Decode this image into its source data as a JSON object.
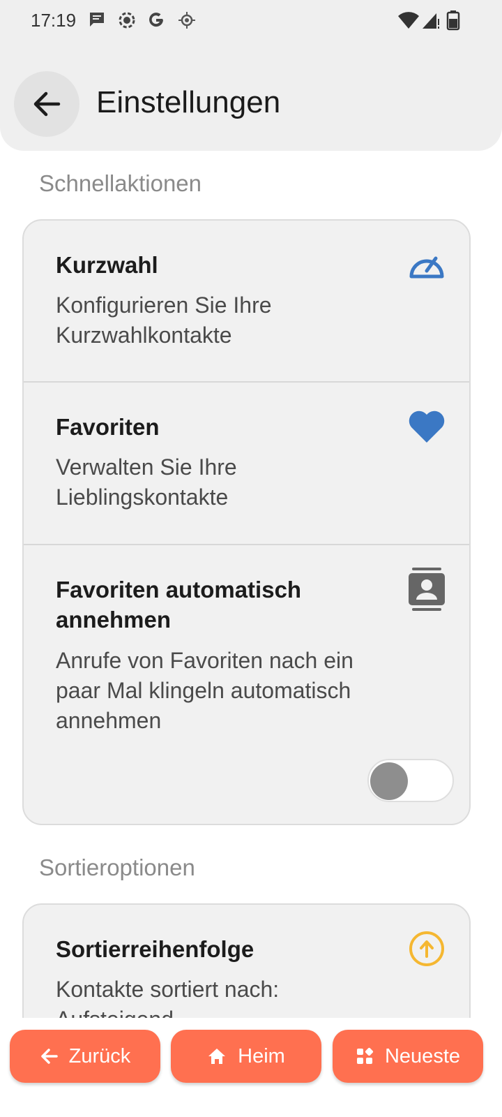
{
  "status_bar": {
    "time": "17:19"
  },
  "header": {
    "title": "Einstellungen"
  },
  "sections": {
    "quick_actions": {
      "title": "Schnellaktionen",
      "items": [
        {
          "title": "Kurzwahl",
          "subtitle": "Konfigurieren Sie Ihre Kurzwahlkontakte",
          "icon": "speedometer-icon"
        },
        {
          "title": "Favoriten",
          "subtitle": "Verwalten Sie Ihre Lieblingskontakte",
          "icon": "heart-icon"
        },
        {
          "title": "Favoriten automatisch annehmen",
          "subtitle": "Anrufe von Favoriten nach ein paar Mal klingeln automatisch annehmen",
          "icon": "contact-card-icon",
          "toggle_on": false
        }
      ]
    },
    "sort_options": {
      "title": "Sortieroptionen",
      "items": [
        {
          "title": "Sortierreihenfolge",
          "subtitle": "Kontakte sortiert nach: Aufsteigend",
          "icon": "arrow-up-circle-icon"
        }
      ]
    }
  },
  "bottom_nav": {
    "back": "Zurück",
    "home": "Heim",
    "recent": "Neueste"
  },
  "colors": {
    "accent_blue": "#3b78c4",
    "accent_orange": "#ff7050",
    "sort_icon": "#f5b731"
  }
}
